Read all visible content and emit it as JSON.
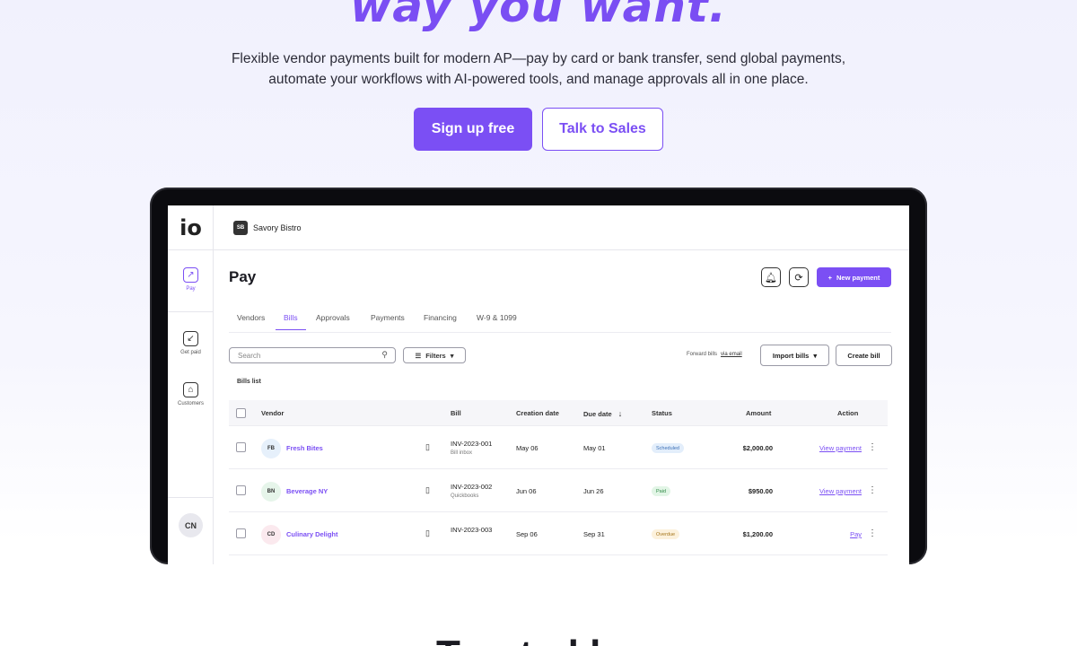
{
  "hero": {
    "title": "way you want.",
    "subtitle_line1": "Flexible vendor payments built for modern AP—pay by card or bank transfer, send global payments,",
    "subtitle_line2": "automate your workflows with AI-powered tools, and manage approvals all in one place.",
    "primary_cta": "Sign up free",
    "secondary_cta": "Talk to Sales",
    "accent_color": "#7b4ff4"
  },
  "app": {
    "logo": "io",
    "org_initials": "SB",
    "org_name": "Savory Bistro",
    "sidebar": [
      {
        "label": "Pay",
        "icon": "arrow-up-right-icon",
        "glyph": "↗",
        "active": true
      },
      {
        "label": "Get paid",
        "icon": "arrow-down-left-icon",
        "glyph": "↙",
        "active": false
      },
      {
        "label": "Customers",
        "icon": "store-icon",
        "glyph": "⌂",
        "active": false
      }
    ],
    "user_initials": "CN",
    "page_title": "Pay",
    "new_payment_label": "New payment",
    "tabs": [
      "Vendors",
      "Bills",
      "Approvals",
      "Payments",
      "Financing",
      "W-9 & 1099"
    ],
    "active_tab": "Bills",
    "search_placeholder": "Search",
    "filters_label": "Filters",
    "forward_bills_label": "Forward bills",
    "forward_bills_link": "via email",
    "import_bills_label": "Import bills",
    "create_bill_label": "Create bill",
    "list_title": "Bills list",
    "columns": [
      "Vendor",
      "Bill",
      "Creation date",
      "Due date",
      "Status",
      "Amount",
      "Action"
    ],
    "rows": [
      {
        "initials": "FB",
        "vendor": "Fresh Bites",
        "bill": "INV-2023-001",
        "source": "Bill inbox",
        "created": "May 06",
        "due": "May 01",
        "status": "Scheduled",
        "amount": "$2,000.00",
        "action": "View payment"
      },
      {
        "initials": "BN",
        "vendor": "Beverage NY",
        "bill": "INV-2023-002",
        "source": "Quickbooks",
        "created": "Jun 06",
        "due": "Jun 26",
        "status": "Paid",
        "amount": "$950.00",
        "action": "View payment"
      },
      {
        "initials": "CD",
        "vendor": "Culinary Delight",
        "bill": "INV-2023-003",
        "source": "",
        "created": "Sep 06",
        "due": "Sep 31",
        "status": "Overdue",
        "amount": "$1,200.00",
        "action": "Pay"
      }
    ],
    "status_colors": {
      "Scheduled": "#e3eefb",
      "Paid": "#e2f5e6",
      "Overdue": "#fcf1dc"
    },
    "avatar_colors": {
      "FB": "#e6f0fb",
      "BN": "#e6f5ea",
      "CD": "#fbe9ee"
    }
  },
  "footer": {
    "heading": "Trusted by"
  }
}
